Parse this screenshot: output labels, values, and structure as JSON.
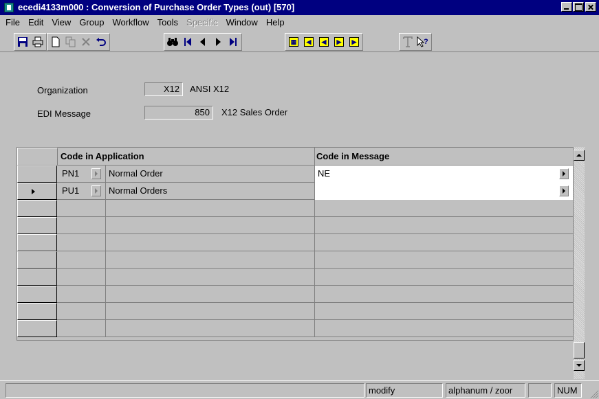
{
  "window": {
    "title": "ecedi4133m000 : Conversion of Purchase Order Types (out) [570]"
  },
  "menu": [
    "File",
    "Edit",
    "View",
    "Group",
    "Workflow",
    "Tools",
    "Specific",
    "Window",
    "Help"
  ],
  "toolbar": {
    "icons": [
      "save-icon",
      "print-icon",
      "new-icon",
      "copy-icon",
      "delete-icon",
      "undo-icon",
      "find-icon",
      "first-record-icon",
      "previous-record-icon",
      "next-record-icon",
      "last-record-icon",
      "form-icon",
      "first-group-icon",
      "previous-group-icon",
      "next-group-icon",
      "last-group-icon",
      "text-icon",
      "help-icon"
    ]
  },
  "form": {
    "organization_label": "Organization",
    "organization_value": "X12",
    "organization_desc": "ANSI X12",
    "message_label": "EDI Message",
    "message_value": "850",
    "message_desc": "X12 Sales Order"
  },
  "grid": {
    "col_app": "Code in Application",
    "col_msg": "Code in Message",
    "rows": [
      {
        "code": "PN1",
        "desc": "Normal Order",
        "msg": "NE"
      },
      {
        "code": "PU1",
        "desc": "Normal Orders",
        "msg": ""
      }
    ]
  },
  "status": {
    "mode": "modify",
    "input": "alphanum / zoor",
    "lock": "NUM"
  }
}
